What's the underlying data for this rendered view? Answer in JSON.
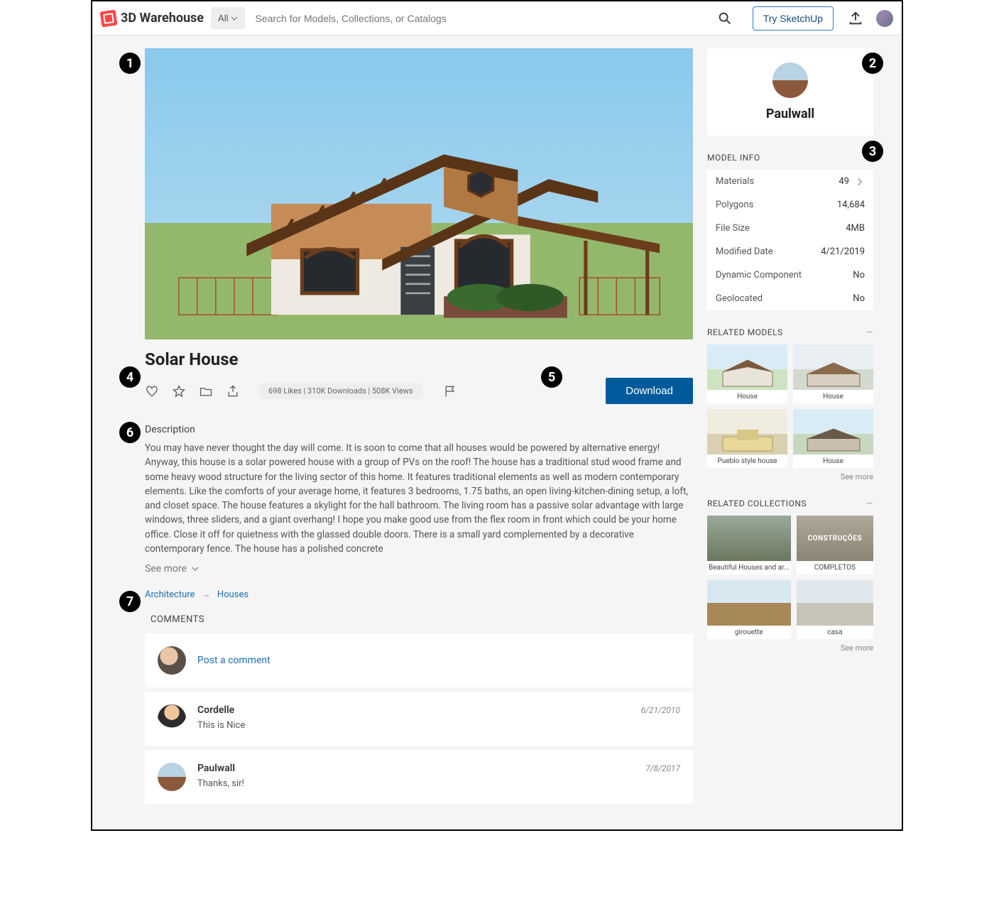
{
  "header": {
    "logo_text": "3D Warehouse",
    "filter_label": "All",
    "search_placeholder": "Search for Models, Collections, or Catalogs",
    "try_label": "Try SketchUp"
  },
  "model": {
    "title": "Solar House",
    "stats": "698 Likes | 310K Downloads | 508K Views",
    "download_label": "Download",
    "desc_label": "Description",
    "description": "You may have never thought the day will come. It is soon to come that all houses would be powered by alternative energy! Anyway, this house is a solar powered house with a group of PVs on the roof! The house has a traditional stud wood frame and some heavy wood structure for the living sector of this home. It features traditional elements as well as modern contemporary elements. Like the comforts of your average home, it features 3 bedrooms, 1.75 baths, an open living-kitchen-dining setup, a loft, and closet space. The house features a skylight for the hall bathroom. The living room has a passive solar advantage with large windows, three sliders, and a giant overhang! I hope you make good use from the flex room in front which could be your home office. Close it off for quietness with the glassed double doors. There is a small yard complemented by a decorative contemporary fence. The house has a polished concrete",
    "see_more_label": "See more",
    "breadcrumb": {
      "root": "Architecture",
      "leaf": "Houses"
    }
  },
  "author": {
    "name": "Paulwall"
  },
  "model_info": {
    "heading": "MODEL INFO",
    "rows": {
      "materials_label": "Materials",
      "materials_val": "49",
      "polygons_label": "Polygons",
      "polygons_val": "14,684",
      "filesize_label": "File Size",
      "filesize_val": "4MB",
      "modified_label": "Modified Date",
      "modified_val": "4/21/2019",
      "dynamic_label": "Dynamic Component",
      "dynamic_val": "No",
      "geo_label": "Geolocated",
      "geo_val": "No"
    }
  },
  "related_models": {
    "heading": "RELATED MODELS",
    "items": [
      "House",
      "House",
      "Pueblo style house",
      "House"
    ],
    "see_more": "See more"
  },
  "related_collections": {
    "heading": "RELATED COLLECTIONS",
    "items": [
      "Beautiful Houses and ar...",
      "COMPLETOS",
      "girouette",
      "casa"
    ],
    "overlay1": "CONSTRUÇÕES",
    "see_more": "See more"
  },
  "comments": {
    "heading": "COMMENTS",
    "post_link": "Post a comment",
    "items": [
      {
        "author": "Cordelle",
        "date": "6/21/2010",
        "text": "This is Nice"
      },
      {
        "author": "Paulwall",
        "date": "7/8/2017",
        "text": "Thanks, sir!"
      }
    ]
  },
  "badges": [
    "1",
    "2",
    "3",
    "4",
    "5",
    "6",
    "7"
  ]
}
